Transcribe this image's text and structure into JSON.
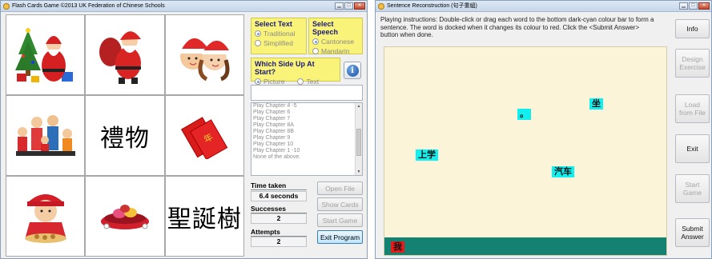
{
  "flashcards": {
    "window_title": "Flash Cards Game ©2013 UK Federation of Chinese Schools",
    "cards": [
      {
        "type": "picture",
        "subject": "santa-with-tree-and-gifts"
      },
      {
        "type": "picture",
        "subject": "santa-with-sack"
      },
      {
        "type": "picture",
        "subject": "girls-in-santa-hats"
      },
      {
        "type": "picture",
        "subject": "family"
      },
      {
        "type": "text",
        "text": "禮物"
      },
      {
        "type": "picture",
        "subject": "red-envelopes"
      },
      {
        "type": "picture",
        "subject": "girl-baking-cookies"
      },
      {
        "type": "picture",
        "subject": "candy-bowl"
      },
      {
        "type": "text",
        "text": "聖誕樹"
      }
    ],
    "select_text": {
      "title": "Select Text",
      "options": [
        {
          "label": "Traditional",
          "selected": true
        },
        {
          "label": "Simplified",
          "selected": false
        }
      ]
    },
    "select_speech": {
      "title": "Select Speech",
      "options": [
        {
          "label": "Cantonese",
          "selected": true
        },
        {
          "label": "Mandarin",
          "selected": false
        }
      ]
    },
    "side_up": {
      "title": "Which Side Up At Start?",
      "options": [
        {
          "label": "Picture",
          "selected": true
        },
        {
          "label": "Text",
          "selected": false
        }
      ]
    },
    "info_button_glyph": "i",
    "chapters": [
      "Play Chapter 4 -5",
      "Play Chapter 6",
      "Play Chapter 7",
      "Play Chapter 8A",
      "Play Chapter 8B",
      "Play Chapter 9",
      "Play Chapter 10",
      "Play Chapter 1 -10",
      "",
      "None of the above."
    ],
    "selected_chapter_index": 8,
    "time_taken_label": "Time taken",
    "time_taken_value": "6.4 seconds",
    "successes_label": "Successes",
    "successes_value": "2",
    "attempts_label": "Attempts",
    "attempts_value": "2",
    "buttons": {
      "open_file": "Open File",
      "show_cards": "Show Cards",
      "start_game": "Start Game",
      "exit_program": "Exit Program"
    }
  },
  "sentence": {
    "window_title": "Sentence Reconstruction (句子重組)",
    "instructions": "Playing instructions: Double-click or drag each word to the bottom dark-cyan colour bar to form a sentence. The word is docked when it changes its colour to red. Click the <Submit Answer> button when done.",
    "words": [
      {
        "text": "坐",
        "docked": false
      },
      {
        "text": "。",
        "docked": false
      },
      {
        "text": "上学",
        "docked": false
      },
      {
        "text": "汽车",
        "docked": false
      },
      {
        "text": "我",
        "docked": true
      }
    ],
    "buttons": {
      "info": "Info",
      "design_exercise": "Design Exercise",
      "load_from_file": "Load from File",
      "exit": "Exit",
      "start_game": "Start Game",
      "submit_answer": "Submit Answer"
    }
  },
  "colors": {
    "yellow_panel": "#f9f37a",
    "canvas_bg": "#fbf4d9",
    "dock_bar": "#138273",
    "word_cyan": "#11efef",
    "word_docked_red": "#e81a1a",
    "list_selection": "#3b82d8"
  }
}
